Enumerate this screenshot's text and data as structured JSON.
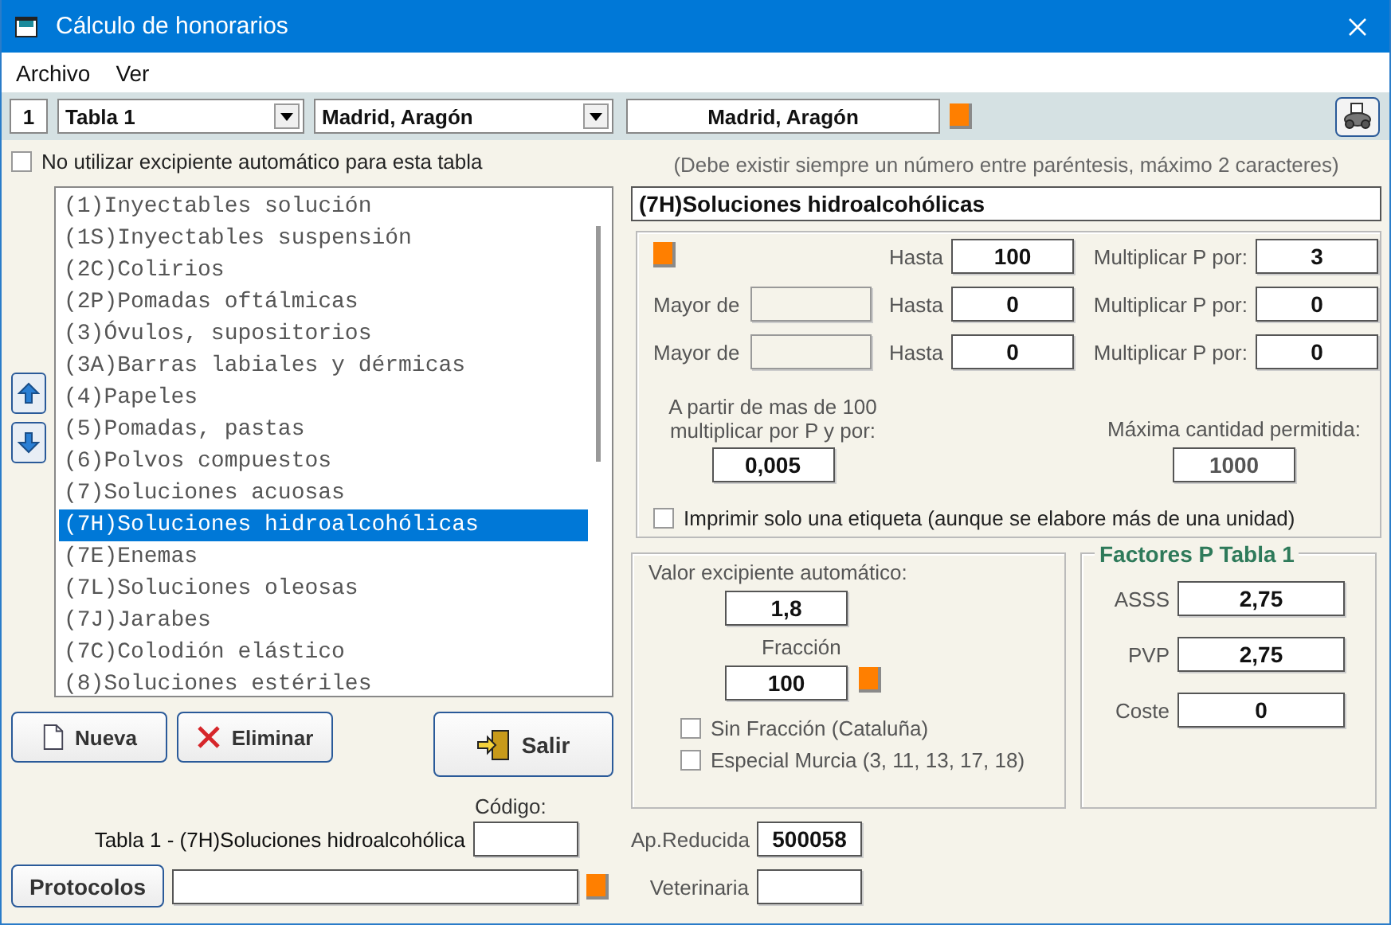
{
  "window": {
    "title": "Cálculo de honorarios"
  },
  "menu": [
    "Archivo",
    "Ver"
  ],
  "toolbar": {
    "number": "1",
    "table_select": "Tabla 1",
    "region_select": "Madrid, Aragón",
    "region_display": "Madrid, Aragón"
  },
  "auto_excipient_option": {
    "label": "No utilizar excipiente automático para esta tabla",
    "checked": false
  },
  "hint": "(Debe existir siempre un número entre paréntesis, máximo 2 caracteres)",
  "name_field": {
    "value": "(7H)Soluciones hidroalcohólicas"
  },
  "list": {
    "items": [
      {
        "label": "(1)Inyectables solución",
        "selected": false
      },
      {
        "label": "(1S)Inyectables suspensión",
        "selected": false
      },
      {
        "label": "(2C)Colirios",
        "selected": false
      },
      {
        "label": "(2P)Pomadas oftálmicas",
        "selected": false
      },
      {
        "label": "(3)Óvulos, supositorios",
        "selected": false
      },
      {
        "label": "(3A)Barras labiales y dérmicas",
        "selected": false
      },
      {
        "label": "(4)Papeles",
        "selected": false
      },
      {
        "label": "(5)Pomadas, pastas",
        "selected": false
      },
      {
        "label": "(6)Polvos compuestos",
        "selected": false
      },
      {
        "label": "(7)Soluciones acuosas",
        "selected": false
      },
      {
        "label": "(7H)Soluciones hidroalcohólicas",
        "selected": true
      },
      {
        "label": "(7E)Enemas",
        "selected": false
      },
      {
        "label": "(7L)Soluciones oleosas",
        "selected": false
      },
      {
        "label": "(7J)Jarabes",
        "selected": false
      },
      {
        "label": "(7C)Colodión elástico",
        "selected": false
      },
      {
        "label": "(8)Soluciones estériles",
        "selected": false
      }
    ]
  },
  "buttons": {
    "new": "Nueva",
    "delete": "Eliminar",
    "exit": "Salir",
    "protocols": "Protocolos"
  },
  "tiers": [
    {
      "kind": "first",
      "to_label": "Hasta",
      "to": "100",
      "mult_label": "Multiplicar P por:",
      "mult": "3"
    },
    {
      "kind": "range",
      "from_label": "Mayor de",
      "to_label": "Hasta",
      "to": "0",
      "mult_label": "Multiplicar P por:",
      "mult": "0"
    },
    {
      "kind": "range",
      "from_label": "Mayor de",
      "to_label": "Hasta",
      "to": "0",
      "mult_label": "Multiplicar P por:",
      "mult": "0"
    }
  ],
  "over_limit": {
    "label": "A partir de mas de 100 multiplicar por P y por:",
    "value": "0,005"
  },
  "max_quantity": {
    "label": "Máxima cantidad permitida:",
    "value": "1000"
  },
  "print_one_option": {
    "label": "Imprimir solo una etiqueta (aunque se elabore más de una unidad)",
    "checked": false
  },
  "excipient": {
    "label": "Valor excipiente automático:",
    "value": "1,8",
    "fraction_label": "Fracción",
    "fraction": "100",
    "options": [
      {
        "label": "Sin Fracción (Cataluña)",
        "checked": false
      },
      {
        "label": "Especial Murcia (3, 11, 13, 17, 18)",
        "checked": false
      }
    ]
  },
  "factors": {
    "title": "Factores P Tabla 1",
    "rows": [
      {
        "label": "ASSS",
        "value": "2,75"
      },
      {
        "label": "PVP",
        "value": "2,75"
      },
      {
        "label": "Coste",
        "value": "0"
      }
    ]
  },
  "code": {
    "label": "Código:",
    "caption": "Tabla 1 - (7H)Soluciones hidroalcohólica"
  },
  "ap_reducida": {
    "label": "Ap.Reducida",
    "value": "500058"
  },
  "veterinaria": {
    "label": "Veterinaria"
  }
}
